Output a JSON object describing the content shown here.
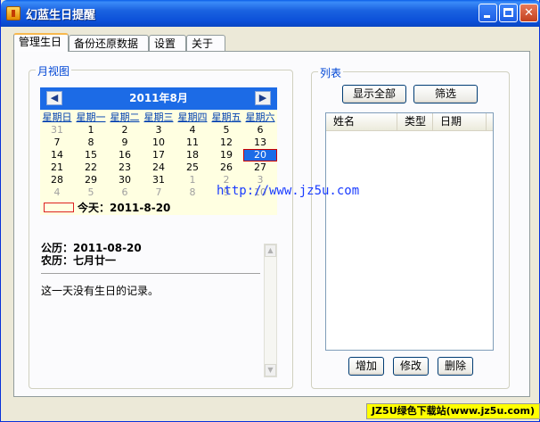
{
  "window": {
    "title": "幻蓝生日提醒"
  },
  "tabs": [
    "管理生日",
    "备份还原数据",
    "设置",
    "关于"
  ],
  "month_view": {
    "group_label": "月视图",
    "header": "2011年8月",
    "prev_icon": "◀",
    "next_icon": "▶",
    "weekdays": [
      "星期日",
      "星期一",
      "星期二",
      "星期三",
      "星期四",
      "星期五",
      "星期六"
    ],
    "weeks": [
      [
        "31",
        "1",
        "2",
        "3",
        "4",
        "5",
        "6"
      ],
      [
        "7",
        "8",
        "9",
        "10",
        "11",
        "12",
        "13"
      ],
      [
        "14",
        "15",
        "16",
        "17",
        "18",
        "19",
        "20"
      ],
      [
        "21",
        "22",
        "23",
        "24",
        "25",
        "26",
        "27"
      ],
      [
        "28",
        "29",
        "30",
        "31",
        "1",
        "2",
        "3"
      ],
      [
        "4",
        "5",
        "6",
        "7",
        "8",
        "9",
        "10"
      ]
    ],
    "selected_day": "20",
    "today_label": "今天：2011-8-20",
    "solar_date": "公历：2011-08-20",
    "lunar_date": "农历：七月廿一",
    "no_record_text": "这一天没有生日的记录。"
  },
  "list": {
    "group_label": "列表",
    "show_all_label": "显示全部",
    "filter_label": "筛选",
    "columns": [
      "姓名",
      "类型",
      "日期"
    ],
    "add_label": "增加",
    "edit_label": "修改",
    "delete_label": "删除"
  },
  "overlay": {
    "url_text": "http://www.jz5u.com",
    "watermark_text": "JZ5U绿色下载站(www.jz5u.com)"
  },
  "colors": {
    "accent": "#1c6be6",
    "calendar_bg": "#ffffe1",
    "title_bar": "#0b4fd8"
  }
}
